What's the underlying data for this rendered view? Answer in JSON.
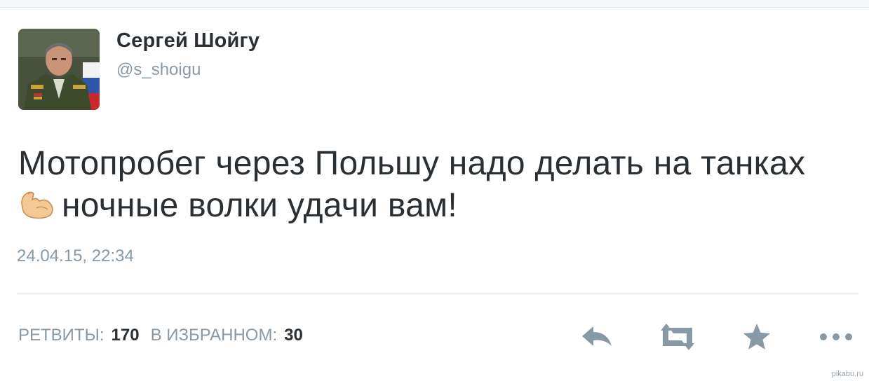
{
  "author": {
    "display_name": "Сергей Шойгу",
    "handle": "@s_shoigu"
  },
  "tweet": {
    "line1": "Мотопробег через Польшу надо делать на танках",
    "emoji": "flexed-biceps",
    "line2": "ночные волки удачи вам!",
    "timestamp": "24.04.15, 22:34"
  },
  "stats": {
    "retweets_label": "РЕТВИТЫ:",
    "retweets_count": "170",
    "favorites_label": "В ИЗБРАННОМ:",
    "favorites_count": "30"
  },
  "actions": [
    "reply-icon",
    "retweet-icon",
    "favorite-icon",
    "more-icon"
  ],
  "colors": {
    "text": "#292f33",
    "muted": "#8899a6",
    "icon": "#8899a6",
    "divider": "#e1e8ed"
  },
  "watermark": "pikabu.ru"
}
